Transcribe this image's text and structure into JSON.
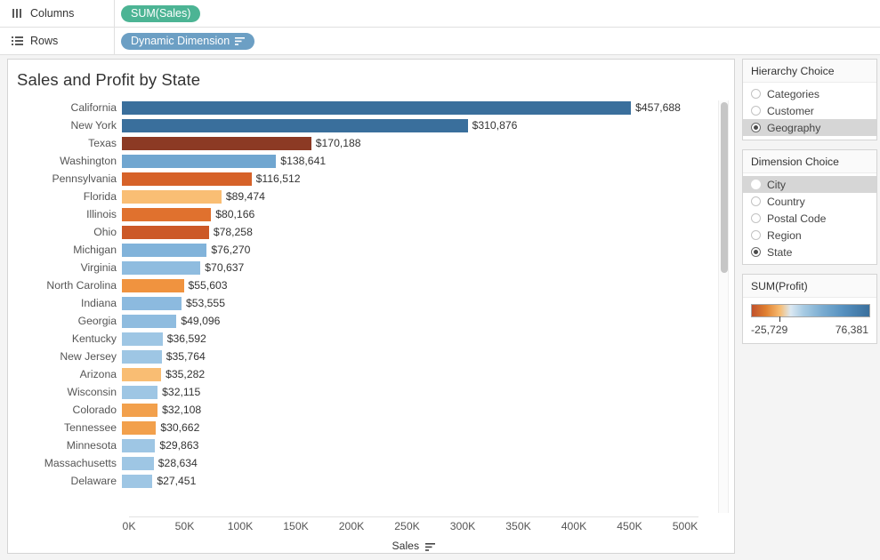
{
  "shelves": {
    "columns": {
      "label": "Columns",
      "icon": "columns-icon",
      "pill": {
        "label": "SUM(Sales)",
        "color": "#4cb494",
        "sort": false
      }
    },
    "rows": {
      "label": "Rows",
      "icon": "rows-icon",
      "pill": {
        "label": "Dynamic Dimension",
        "color": "#6c9fc4",
        "sort": true
      }
    }
  },
  "chart_data": {
    "type": "bar",
    "orientation": "horizontal",
    "title": "Sales and Profit by State",
    "xlabel": "Sales",
    "ylabel": "",
    "xlim": [
      0,
      512000
    ],
    "xticks": [
      0,
      50000,
      100000,
      150000,
      200000,
      250000,
      300000,
      350000,
      400000,
      450000,
      500000
    ],
    "xticklabels": [
      "0K",
      "50K",
      "100K",
      "150K",
      "200K",
      "250K",
      "300K",
      "350K",
      "400K",
      "450K",
      "500K"
    ],
    "grid": false,
    "legend": "SUM(Profit) color legend, right panel",
    "color_encoding": "SUM(Profit)",
    "categories": [
      "California",
      "New York",
      "Texas",
      "Washington",
      "Pennsylvania",
      "Florida",
      "Illinois",
      "Ohio",
      "Michigan",
      "Virginia",
      "North Carolina",
      "Indiana",
      "Georgia",
      "Kentucky",
      "New Jersey",
      "Arizona",
      "Wisconsin",
      "Colorado",
      "Tennessee",
      "Minnesota",
      "Massachusetts",
      "Delaware"
    ],
    "values": [
      457688,
      310876,
      170188,
      138641,
      116512,
      89474,
      80166,
      78258,
      76270,
      70637,
      55603,
      53555,
      49096,
      36592,
      35764,
      35282,
      32115,
      32108,
      30662,
      29863,
      28634,
      27451
    ],
    "value_labels": [
      "$457,688",
      "$310,876",
      "$170,188",
      "$138,641",
      "$116,512",
      "$89,474",
      "$80,166",
      "$78,258",
      "$76,270",
      "$70,637",
      "$55,603",
      "$53,555",
      "$49,096",
      "$36,592",
      "$35,764",
      "$35,282",
      "$32,115",
      "$32,108",
      "$30,662",
      "$29,863",
      "$28,634",
      "$27,451"
    ],
    "bar_colors": [
      "#3a6f9c",
      "#3a6f9c",
      "#8c3a24",
      "#70a6d0",
      "#d66229",
      "#f9be74",
      "#e0712e",
      "#cc5827",
      "#81b3da",
      "#8fbcdf",
      "#f0933f",
      "#8cbadf",
      "#8fbcdf",
      "#9ec6e4",
      "#9ec6e4",
      "#f9bd73",
      "#9ec6e4",
      "#f2a04c",
      "#f2a04c",
      "#9ec6e4",
      "#9ec6e4",
      "#9ec6e4"
    ]
  },
  "sidebar": {
    "hierarchy": {
      "title": "Hierarchy Choice",
      "options": [
        {
          "label": "Categories",
          "selected": false,
          "hovered": false
        },
        {
          "label": "Customer",
          "selected": false,
          "hovered": false
        },
        {
          "label": "Geography",
          "selected": true,
          "hovered": true
        }
      ]
    },
    "dimension": {
      "title": "Dimension Choice",
      "options": [
        {
          "label": "City",
          "selected": false,
          "hovered": true
        },
        {
          "label": "Country",
          "selected": false,
          "hovered": false
        },
        {
          "label": "Postal Code",
          "selected": false,
          "hovered": false
        },
        {
          "label": "Region",
          "selected": false,
          "hovered": false
        },
        {
          "label": "State",
          "selected": true,
          "hovered": false
        }
      ]
    },
    "legend": {
      "title": "SUM(Profit)",
      "min_label": "-25,729",
      "max_label": "76,381",
      "min_value": -25729,
      "max_value": 76381
    }
  }
}
